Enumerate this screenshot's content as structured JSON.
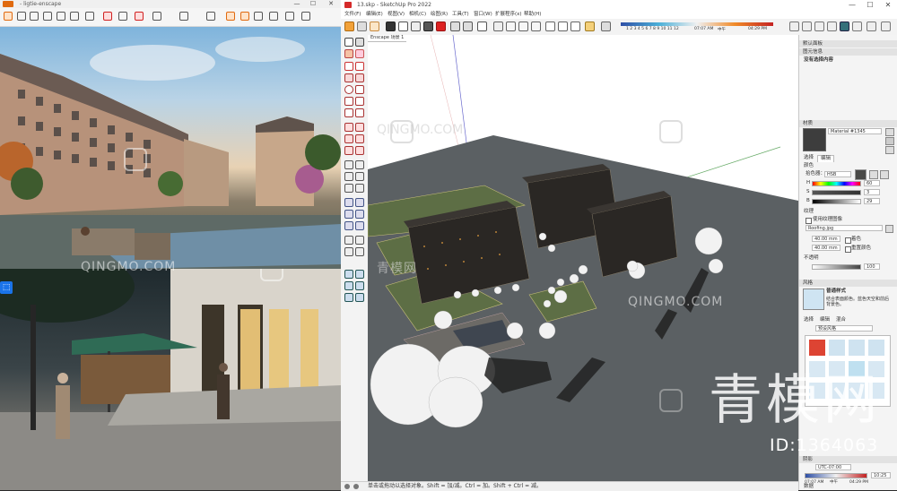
{
  "enscape": {
    "title": "- ligtie-enscape",
    "window_controls": [
      "—",
      "☐",
      "✕"
    ]
  },
  "sketchup": {
    "title": "13.skp - SketchUp Pro 2022",
    "window_controls": [
      "—",
      "☐",
      "✕"
    ],
    "menu": [
      "文件(F)",
      "编辑(E)",
      "视图(V)",
      "相机(C)",
      "绘图(R)",
      "工具(T)",
      "窗口(W)",
      "扩展程序(x)",
      "帮助(H)"
    ],
    "shadow": {
      "months": "1 2 3 4 5 6 7 8 9 10 11 12",
      "time_start": "07:07 AM",
      "time_mid": "中午",
      "time_end": "04:29 PM"
    },
    "scene_tab": "Enscape  场景 1",
    "status_text": "单击或拖动以选择对象。Shift = 加/减。Ctrl = 加。Shift + Ctrl = 减。"
  },
  "tray": {
    "default_panel": "默认面板",
    "entity_info": "图元信息",
    "no_selection": "没有选择内容",
    "materials": "材质",
    "material_name": "Material #1345",
    "tabs_select": "选择",
    "tabs_edit": "编辑",
    "color_label": "颜色",
    "picker_label": "拾色器：",
    "picker_mode": "HSB",
    "h_label": "H",
    "s_label": "S",
    "b_label": "B",
    "h_value": "60",
    "s_value": "3",
    "b_value": "29",
    "texture_label": "纹理",
    "use_texture": "使用纹理图像",
    "texture_file": "Roofing.jpg",
    "width_value": "40.00 mm",
    "height_value": "40.00 mm",
    "colorize": "着色",
    "reset_color": "重置颜色",
    "opacity_label": "不透明",
    "opacity_value": "100",
    "styles": "风格",
    "style_name": "普通样式",
    "style_desc": "结合表面颜色。蓝色天空和前后背景色。",
    "styles_tabs": [
      "选择",
      "编辑",
      "混合"
    ],
    "styles_dropdown": "预设风格",
    "shadows_head": "阴影",
    "utc": "UTC-07:00",
    "time_a": "07:07 AM",
    "time_b": "中午",
    "time_c": "04:29 PM",
    "time_value": "10:25",
    "bottom_label": "数据"
  },
  "watermark": {
    "small": "QINGMO.COM",
    "cn": "青模网",
    "big": "青模网",
    "id": "ID:1364063"
  },
  "colors": {
    "ground": "#5b6063",
    "grass": "#5d6e45",
    "building": "#2a2724",
    "tree_white": "#f2f2f2"
  }
}
